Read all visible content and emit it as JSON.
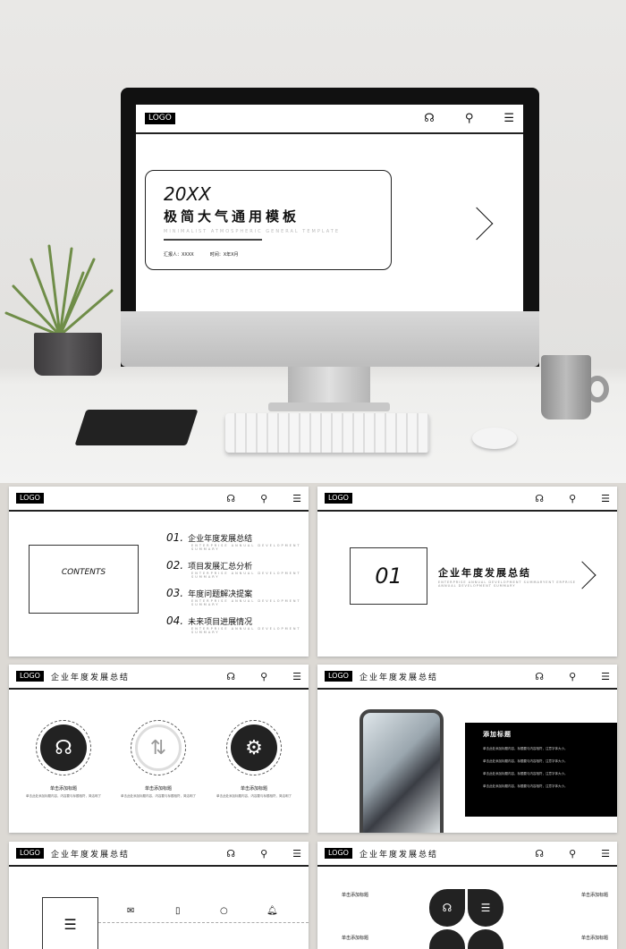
{
  "hero": {
    "logo": "LOGO",
    "year": "20XX",
    "title": "极简大气通用模板",
    "subtitle": "MINIMALIST ATMOSPHERIC GENERAL TEMPLATE",
    "reporter": "汇报人：XXXX",
    "time": "时间：X年X月"
  },
  "icons": {
    "service": "headset-icon",
    "search": "search-icon",
    "menu": "menu-icon"
  },
  "contents": {
    "logo": "LOGO",
    "title": "CONTENTS",
    "items": [
      {
        "num": "01.",
        "label": "企业年度发展总结",
        "en": "ENTERPRISE ANNUAL DEVELOPMENT SUMMARY"
      },
      {
        "num": "02.",
        "label": "项目发展汇总分析",
        "en": "ENTERPRISE ANNUAL DEVELOPMENT SUMMARY"
      },
      {
        "num": "03.",
        "label": "年度问题解决提案",
        "en": "ENTERPRISE ANNUAL DEVELOPMENT SUMMARY"
      },
      {
        "num": "04.",
        "label": "未来项目进展情况",
        "en": "ENTERPRISE ANNUAL DEVELOPMENT SUMMARY"
      }
    ]
  },
  "section": {
    "logo": "LOGO",
    "num": "01",
    "title": "企业年度发展总结",
    "en": "ENTERPRISE ANNUAL DEVELOPMENT SUMMARYENT ERPRISE ANNUAL DEVELOPMENT SUMMARY"
  },
  "slide3": {
    "logo": "LOGO",
    "title": "企业年度发展总结",
    "items": [
      {
        "title": "单击添加标题",
        "text": "单击此处添加标题内容，内容要与标题相符，简洁明了"
      },
      {
        "title": "单击添加标题",
        "text": "单击此处添加标题内容，内容要与标题相符，简洁明了"
      },
      {
        "title": "单击添加标题",
        "text": "单击此处添加标题内容，内容要与标题相符，简洁明了"
      }
    ]
  },
  "slide4": {
    "logo": "LOGO",
    "title": "企业年度发展总结",
    "box_title": "添加标题",
    "paras": [
      "单击此处添加标题内容，标题要与内容相符，注意字体大小。",
      "单击此处添加标题内容，标题要与内容相符，注意字体大小。",
      "单击此处添加标题内容，标题要与内容相符，注意字体大小。",
      "单击此处添加标题内容，标题要与内容相符，注意字体大小。"
    ]
  },
  "slide5": {
    "logo": "LOGO",
    "title": "企业年度发展总结"
  },
  "slide6": {
    "logo": "LOGO",
    "title": "企业年度发展总结",
    "left_title": "单击添加标题",
    "right_title": "单击添加标题",
    "left_title2": "单击添加标题",
    "right_title2": "单击添加标题"
  }
}
